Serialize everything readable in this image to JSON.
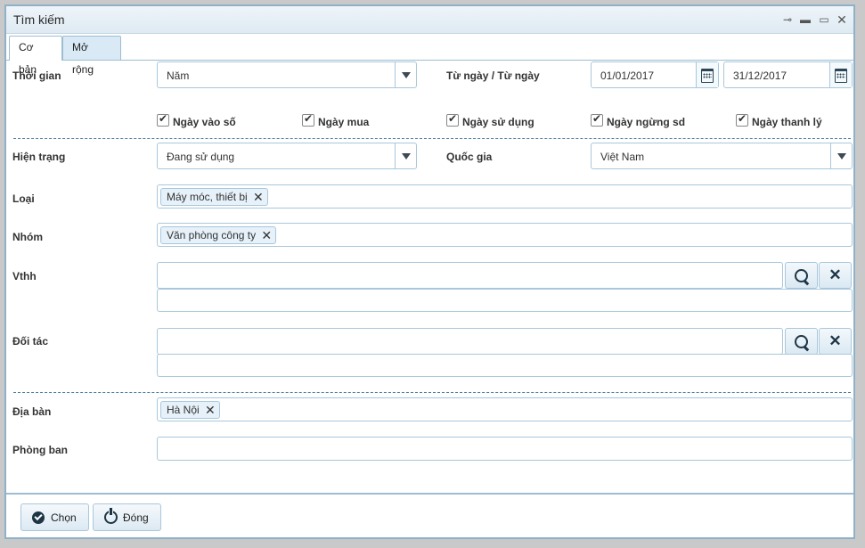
{
  "window": {
    "title": "Tìm kiếm",
    "controls": [
      "pin-icon",
      "minimize-icon",
      "maximize-icon",
      "close-icon"
    ]
  },
  "tabs": [
    {
      "label": "Cơ bản",
      "active": true
    },
    {
      "label": "Mở rộng",
      "active": false
    }
  ],
  "form": {
    "time": {
      "label": "Thời gian",
      "value": "Năm"
    },
    "date_range": {
      "label": "Từ ngày / Từ ngày",
      "from": "01/01/2017",
      "to": "31/12/2017"
    },
    "checkboxes": [
      {
        "label": "Ngày vào số",
        "checked": true
      },
      {
        "label": "Ngày mua",
        "checked": true
      },
      {
        "label": "Ngày sử dụng",
        "checked": true
      },
      {
        "label": "Ngày ngừng sd",
        "checked": true
      },
      {
        "label": "Ngày thanh lý",
        "checked": true
      }
    ],
    "status": {
      "label": "Hiện trạng",
      "value": "Đang sử dụng"
    },
    "country": {
      "label": "Quốc gia",
      "value": "Việt Nam"
    },
    "type": {
      "label": "Loại",
      "tags": [
        "Máy móc, thiết bị"
      ]
    },
    "group": {
      "label": "Nhóm",
      "tags": [
        "Văn phòng công ty"
      ]
    },
    "vthh": {
      "label": "Vthh",
      "value": "",
      "value2": ""
    },
    "partner": {
      "label": "Đối tác",
      "value": "",
      "value2": ""
    },
    "area": {
      "label": "Địa bàn",
      "tags": [
        "Hà Nội"
      ]
    },
    "department": {
      "label": "Phòng ban",
      "value": ""
    }
  },
  "footer": {
    "choose_label": "Chọn",
    "close_label": "Đóng"
  },
  "colors": {
    "border": "#a9c7dc",
    "separator": "#4a7ca0",
    "tab_inactive": "#d9eaf6",
    "icon_dark": "#1e3546"
  }
}
